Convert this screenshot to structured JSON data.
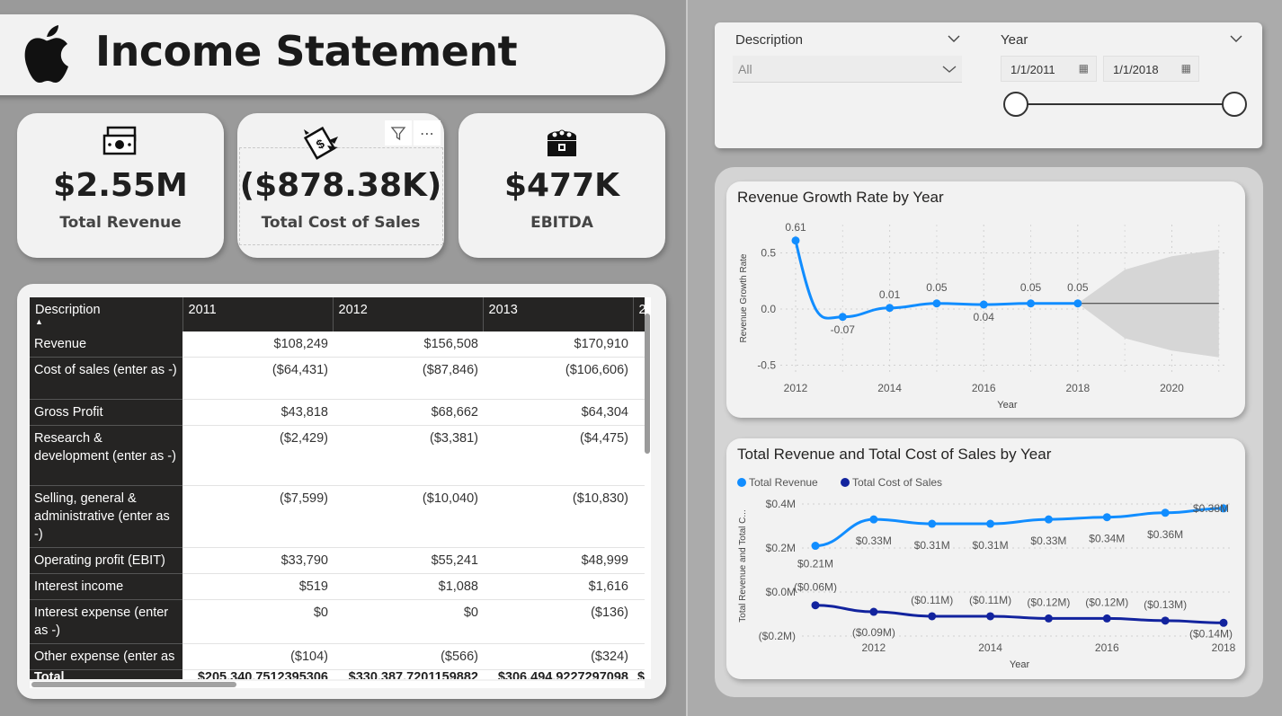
{
  "title": "Income Statement",
  "kpis": [
    {
      "value": "$2.55M",
      "label": "Total Revenue",
      "icon": "money-bill-icon"
    },
    {
      "value": "($878.38K)",
      "label": "Total Cost of Sales",
      "icon": "flying-money-icon"
    },
    {
      "value": "$477K",
      "label": "EBITDA",
      "icon": "treasure-chest-icon"
    }
  ],
  "kpi_tools": {
    "filter_icon": "filter-icon",
    "more_icon": "more-options-icon"
  },
  "table": {
    "headers": [
      "Description",
      "2011",
      "2012",
      "2013",
      "2"
    ],
    "rows": [
      {
        "desc": "Revenue",
        "values": [
          "$108,249",
          "$156,508",
          "$170,910"
        ]
      },
      {
        "desc": "Cost of sales (enter as -)",
        "values": [
          "($64,431)",
          "($87,846)",
          "($106,606)"
        ]
      },
      {
        "desc": "Gross Profit",
        "values": [
          "$43,818",
          "$68,662",
          "$64,304"
        ]
      },
      {
        "desc": "Research & development (enter as -)",
        "values": [
          "($2,429)",
          "($3,381)",
          "($4,475)"
        ]
      },
      {
        "desc": "Selling, general & administrative (enter as -)",
        "values": [
          "($7,599)",
          "($10,040)",
          "($10,830)"
        ]
      },
      {
        "desc": "Operating profit (EBIT)",
        "values": [
          "$33,790",
          "$55,241",
          "$48,999"
        ]
      },
      {
        "desc": "Interest income",
        "values": [
          "$519",
          "$1,088",
          "$1,616"
        ]
      },
      {
        "desc": "Interest expense (enter as -)",
        "values": [
          "$0",
          "$0",
          "($136)"
        ]
      },
      {
        "desc": "Other expense (enter as",
        "values": [
          "($104)",
          "($566)",
          "($324)"
        ]
      }
    ],
    "total": {
      "desc": "Total",
      "values": [
        "$205,340.7512395306",
        "$330,387.7201159882",
        "$306,494.9227297098",
        "$"
      ]
    }
  },
  "slicers": {
    "description_label": "Description",
    "description_value": "All",
    "year_label": "Year",
    "date_start": "1/1/2011",
    "date_end": "1/1/2018"
  },
  "chart_data": [
    {
      "type": "line",
      "title": "Revenue Growth Rate by Year",
      "xlabel": "Year",
      "ylabel": "Revenue Growth Rate",
      "x": [
        2012,
        2013,
        2014,
        2015,
        2016,
        2017,
        2018
      ],
      "y": [
        0.61,
        -0.07,
        0.01,
        0.05,
        0.04,
        0.05,
        0.05
      ],
      "data_labels": [
        "0.61",
        "-0.07",
        "0.01",
        "0.05",
        "0.04",
        "0.05",
        "0.05"
      ],
      "xticks": [
        "2012",
        "2014",
        "2016",
        "2018",
        "2020"
      ],
      "yticks": [
        "0.5",
        "0.0",
        "-0.5"
      ],
      "forecast": {
        "x": [
          2018,
          2019,
          2020,
          2021
        ],
        "upper": [
          0.05,
          0.35,
          0.47,
          0.53
        ],
        "lower": [
          0.05,
          -0.26,
          -0.37,
          -0.43
        ],
        "mid": 0.05
      },
      "color": "#118dff"
    },
    {
      "type": "line",
      "title": "Total Revenue and Total Cost of Sales by Year",
      "xlabel": "Year",
      "ylabel": "Total Revenue and Total C...",
      "x": [
        2011,
        2012,
        2013,
        2014,
        2015,
        2016,
        2017,
        2018
      ],
      "xticks": [
        "2012",
        "2014",
        "2016",
        "2018"
      ],
      "yticks": [
        "$0.4M",
        "$0.2M",
        "$0.0M",
        "($0.2M)"
      ],
      "series": [
        {
          "name": "Total Revenue",
          "color": "#118dff",
          "values": [
            0.21,
            0.33,
            0.31,
            0.31,
            0.33,
            0.34,
            0.36,
            0.38
          ],
          "labels": [
            "$0.21M",
            "$0.33M",
            "$0.31M",
            "$0.31M",
            "$0.33M",
            "$0.34M",
            "$0.36M",
            "$0.38M"
          ]
        },
        {
          "name": "Total Cost of Sales",
          "color": "#12239e",
          "values": [
            -0.06,
            -0.09,
            -0.11,
            -0.11,
            -0.12,
            -0.12,
            -0.13,
            -0.14
          ],
          "labels": [
            "($0.06M)",
            "($0.09M)",
            "($0.11M)",
            "($0.11M)",
            "($0.12M)",
            "($0.12M)",
            "($0.13M)",
            "($0.14M)"
          ]
        }
      ]
    }
  ]
}
